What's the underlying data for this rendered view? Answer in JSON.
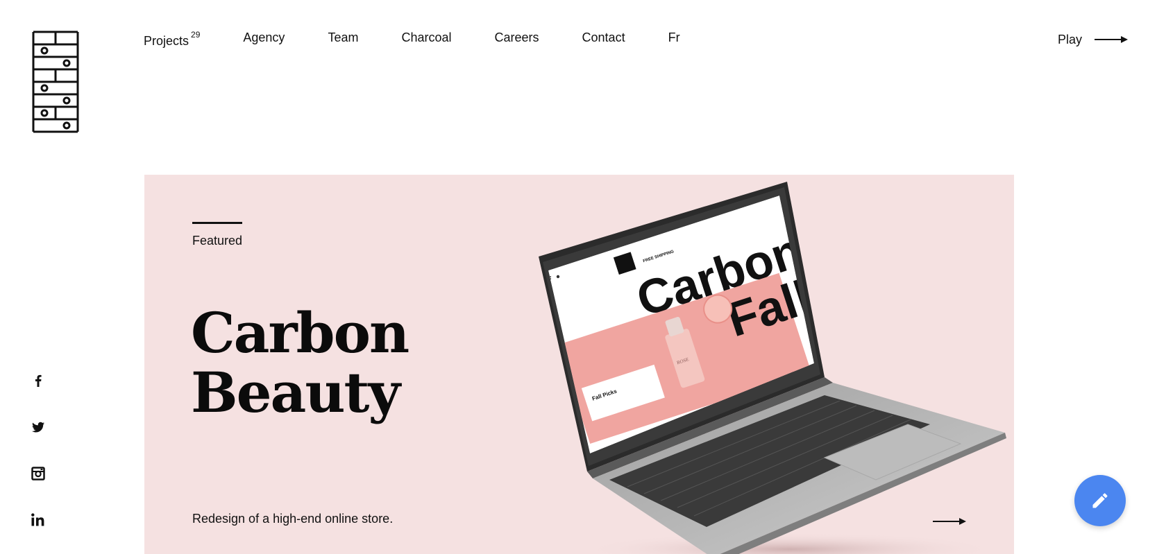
{
  "nav": {
    "items": [
      {
        "label": "Projects",
        "count": "29"
      },
      {
        "label": "Agency"
      },
      {
        "label": "Team"
      },
      {
        "label": "Charcoal"
      },
      {
        "label": "Careers"
      },
      {
        "label": "Contact"
      },
      {
        "label": "Fr"
      }
    ],
    "play_label": "Play"
  },
  "social": [
    "facebook-icon",
    "twitter-icon",
    "instagram-icon",
    "linkedin-icon"
  ],
  "hero": {
    "featured_label": "Featured",
    "title_line1": "Carbon",
    "title_line2": "Beauty",
    "description": "Redesign of a high-end online store.",
    "screen_headline_1": "Carbon",
    "screen_headline_2": "Fall",
    "screen_card_title": "Fall Picks",
    "screen_bottle_text": "ROSE",
    "background_color": "#f5e1e1"
  },
  "colors": {
    "accent": "#4b86f0",
    "text": "#111111"
  }
}
